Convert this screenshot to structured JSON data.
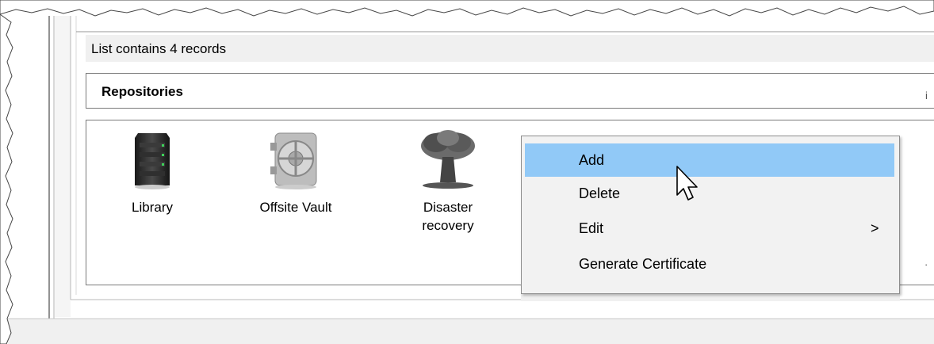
{
  "status": {
    "text": "List contains 4 records"
  },
  "repositories": {
    "title": "Repositories",
    "items": [
      {
        "label_line1": "Library",
        "label_line2": "",
        "icon": "server-icon"
      },
      {
        "label_line1": "Offsite Vault",
        "label_line2": "",
        "icon": "vault-icon"
      },
      {
        "label_line1": "Disaster",
        "label_line2": "recovery",
        "icon": "explosion-icon"
      }
    ]
  },
  "context_menu": {
    "items": [
      {
        "label": "Add",
        "highlighted": true
      },
      {
        "label": "Delete"
      },
      {
        "label": "Edit",
        "submenu_arrow": ">"
      },
      {
        "label": "Generate Certificate"
      }
    ]
  },
  "colors": {
    "menu_highlight": "#91c9f7",
    "menu_background": "#f2f2f2",
    "border": "#7a7a7a"
  }
}
